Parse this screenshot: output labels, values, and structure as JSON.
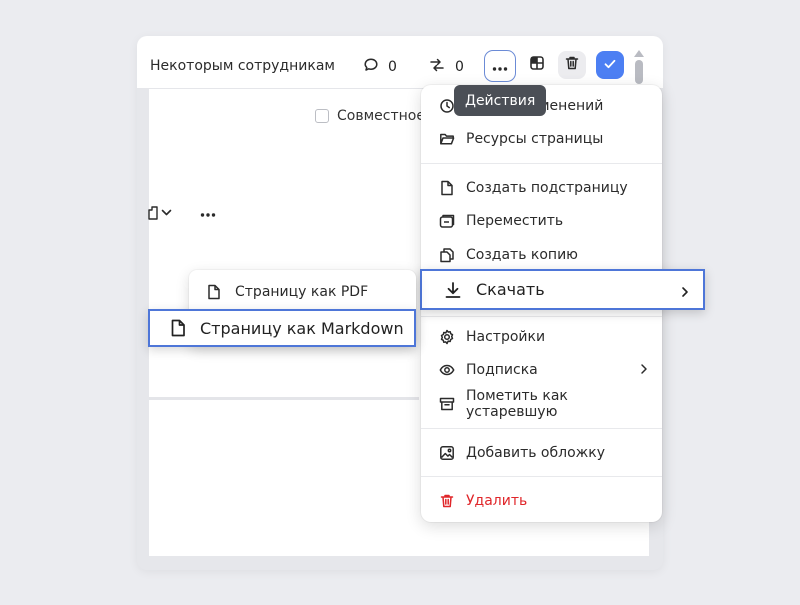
{
  "toolbar": {
    "access_label": "Некоторым сотрудникам",
    "comment_count": "0",
    "changes_count": "0"
  },
  "tooltip": {
    "text": "Действия"
  },
  "page": {
    "coedit_label": "Совместное"
  },
  "menu": {
    "history_label": "менений",
    "resources_label": "Ресурсы страницы",
    "create_subpage_label": "Создать подстраницу",
    "move_label": "Переместить",
    "copy_label": "Создать копию",
    "download_label": "Скачать",
    "settings_label": "Настройки",
    "subscription_label": "Подписка",
    "mark_outdated_label": "Пометить как устаревшую",
    "add_cover_label": "Добавить обложку",
    "delete_label": "Удалить"
  },
  "download_submenu": {
    "pdf_label": "Страницу как PDF",
    "markdown_label": "Страницу как Markdown"
  },
  "colors": {
    "accent": "#4c7ff3",
    "highlight_border": "#4e76d8",
    "danger": "#e0262a",
    "tooltip_bg": "#4b4f56"
  }
}
